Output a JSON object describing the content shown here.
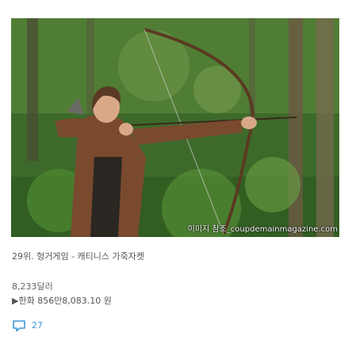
{
  "image": {
    "credit": "이미지 참조_coupdemainmagazine.com"
  },
  "post": {
    "title": "29위. 헝거게임 - 캐티니스 가죽자켓",
    "price_usd": "8,233달러",
    "price_krw": "▶한화 856만8,083.10 원"
  },
  "comments": {
    "icon": "comment-bubble-icon",
    "count": "27",
    "color": "#3d98d6"
  }
}
